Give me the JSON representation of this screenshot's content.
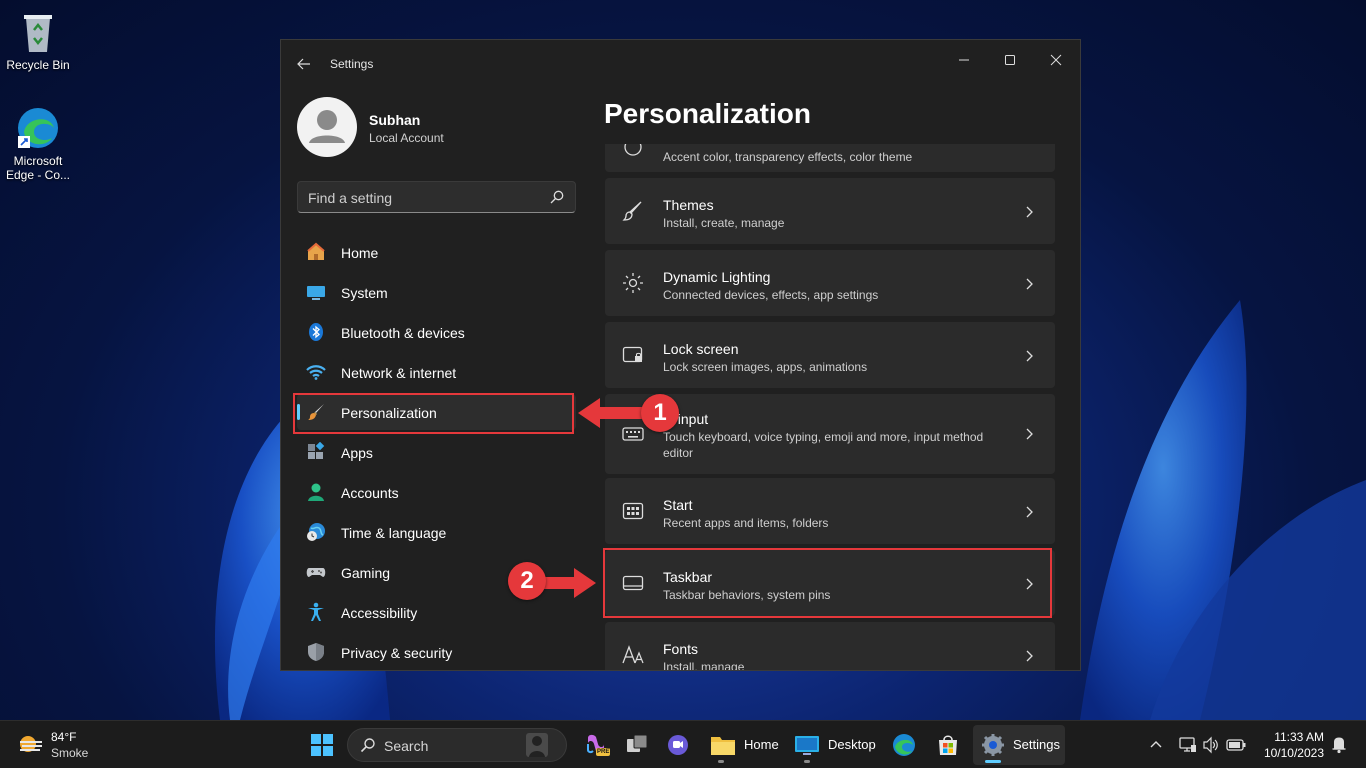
{
  "desktop": {
    "icons": [
      {
        "label": "Recycle Bin"
      },
      {
        "label": "Microsoft Edge - Co..."
      }
    ]
  },
  "window": {
    "title": "Settings",
    "minimize_glyph": "—",
    "maximize_glyph": "☐",
    "close_glyph": "✕"
  },
  "profile": {
    "name": "Subhan",
    "account_type": "Local Account"
  },
  "search": {
    "placeholder": "Find a setting"
  },
  "nav": {
    "items": [
      {
        "label": "Home"
      },
      {
        "label": "System"
      },
      {
        "label": "Bluetooth & devices"
      },
      {
        "label": "Network & internet"
      },
      {
        "label": "Personalization"
      },
      {
        "label": "Apps"
      },
      {
        "label": "Accounts"
      },
      {
        "label": "Time & language"
      },
      {
        "label": "Gaming"
      },
      {
        "label": "Accessibility"
      },
      {
        "label": "Privacy & security"
      }
    ],
    "active": "Personalization"
  },
  "main": {
    "title": "Personalization",
    "rows": [
      {
        "title": "",
        "subtitle": "Accent color, transparency effects, color theme",
        "icon": "palette-icon"
      },
      {
        "title": "Themes",
        "subtitle": "Install, create, manage",
        "icon": "brush-icon"
      },
      {
        "title": "Dynamic Lighting",
        "subtitle": "Connected devices, effects, app settings",
        "icon": "lighting-icon"
      },
      {
        "title": "Lock screen",
        "subtitle": "Lock screen images, apps, animations",
        "icon": "lock-screen-icon"
      },
      {
        "title": "xt input",
        "subtitle": "Touch keyboard, voice typing, emoji and more, input method",
        "subtitle2": "editor",
        "icon": "keyboard-icon"
      },
      {
        "title": "Start",
        "subtitle": "Recent apps and items, folders",
        "icon": "start-icon"
      },
      {
        "title": "Taskbar",
        "subtitle": "Taskbar behaviors, system pins",
        "icon": "taskbar-icon"
      },
      {
        "title": "Fonts",
        "subtitle": "Install, manage",
        "icon": "fonts-icon"
      }
    ]
  },
  "annotations": {
    "step1": "1",
    "step2": "2",
    "color": "#e5383b"
  },
  "taskbar": {
    "weather_temp": "84°F",
    "weather_condition": "Smoke",
    "search_label": "Search",
    "pre_badge": "PRE",
    "apps": [
      {
        "label": "Home"
      },
      {
        "label": "Desktop"
      },
      {
        "label": "Settings"
      }
    ],
    "time": "11:33 AM",
    "date": "10/10/2023"
  },
  "colors": {
    "accent": "#60cdff",
    "window_bg": "#202020",
    "card_bg": "#2b2b2b"
  }
}
